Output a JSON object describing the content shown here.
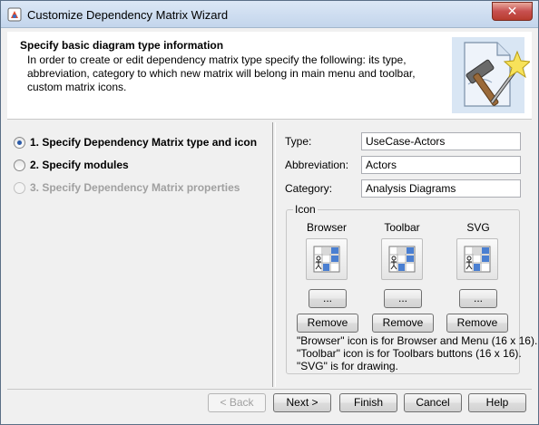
{
  "window": {
    "title": "Customize Dependency Matrix Wizard",
    "close_glyph": "✕"
  },
  "header": {
    "title": "Specify basic diagram type information",
    "description": "In order to create or edit dependency matrix type specify the following: its type, abbreviation, category to which new matrix will belong in main menu and toolbar, custom matrix icons.",
    "graphic_icon": "wizard-hammer-wand-icon"
  },
  "steps": [
    {
      "label": "1. Specify Dependency Matrix type and icon",
      "state": "selected"
    },
    {
      "label": "2. Specify modules",
      "state": "enabled"
    },
    {
      "label": "3. Specify Dependency Matrix properties",
      "state": "disabled"
    }
  ],
  "form": {
    "type_label": "Type:",
    "type_value": "UseCase-Actors",
    "abbreviation_label": "Abbreviation:",
    "abbreviation_value": "Actors",
    "category_label": "Category:",
    "category_value": "Analysis Diagrams"
  },
  "icon_group": {
    "legend": "Icon",
    "columns": [
      {
        "label": "Browser",
        "browse_label": "...",
        "remove_label": "Remove"
      },
      {
        "label": "Toolbar",
        "browse_label": "...",
        "remove_label": "Remove"
      },
      {
        "label": "SVG",
        "browse_label": "...",
        "remove_label": "Remove"
      }
    ],
    "notes": [
      "\"Browser\" icon is for Browser and Menu (16 x 16).",
      "\"Toolbar\" icon is for Toolbars buttons (16 x 16).",
      "\"SVG\" is for drawing."
    ]
  },
  "footer": {
    "back_label": "< Back",
    "next_label": "Next >",
    "finish_label": "Finish",
    "cancel_label": "Cancel",
    "help_label": "Help"
  },
  "colors": {
    "titlebar": "#c3d5ec",
    "close_button": "#c75050",
    "radio_selected": "#2a5aa8"
  }
}
